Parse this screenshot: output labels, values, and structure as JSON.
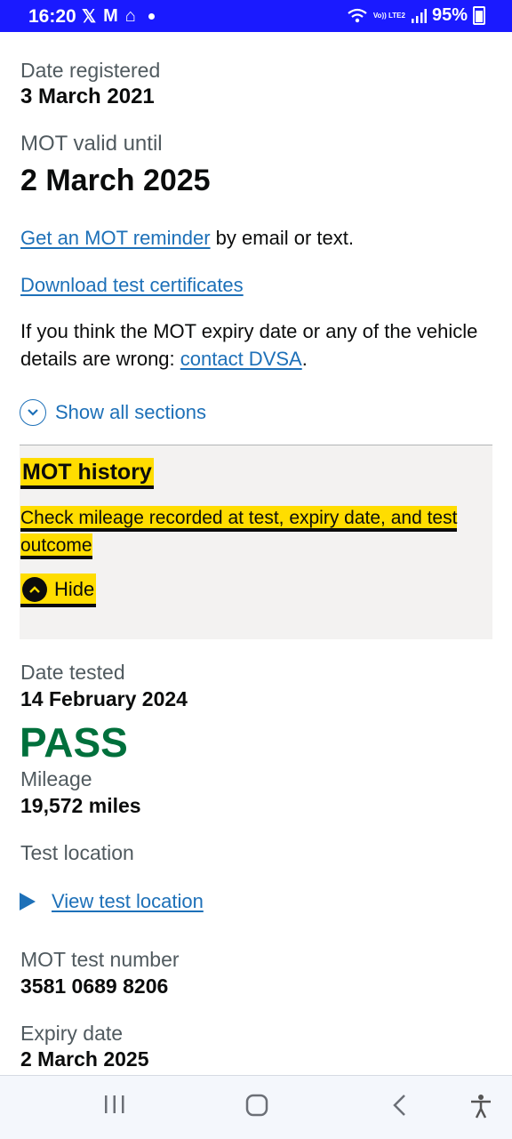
{
  "status_bar": {
    "time": "16:20",
    "left_icons": [
      "x-icon",
      "gmail-icon",
      "home-icon",
      "dot-icon"
    ],
    "network": "Vo)) LTE2",
    "battery": "95%"
  },
  "vehicle": {
    "date_registered_label": "Date registered",
    "date_registered_value": "3 March 2021",
    "mot_valid_label": "MOT valid until",
    "mot_valid_value": "2 March 2025"
  },
  "links": {
    "mot_reminder_link": "Get an MOT reminder",
    "mot_reminder_suffix": " by email or text.",
    "download_link": "Download test certificates",
    "wrong_details_text": "If you think the MOT expiry date or any of the vehicle details are wrong: ",
    "contact_link": "contact DVSA",
    "contact_suffix": "."
  },
  "show_all": {
    "label": "Show all sections"
  },
  "accordion": {
    "title": "MOT history",
    "summary": "Check mileage recorded at test, expiry date, and test outcome",
    "hide_label": "Hide"
  },
  "test": {
    "date_tested_label": "Date tested",
    "date_tested_value": "14 February 2024",
    "result": "PASS",
    "mileage_label": "Mileage",
    "mileage_value": "19,572 miles",
    "location_label": "Test location",
    "location_link": "View test location",
    "test_number_label": "MOT test number",
    "test_number_value": "3581 0689 8206",
    "expiry_label": "Expiry date",
    "expiry_value": "2 March 2025"
  },
  "colors": {
    "link": "#1d70b8",
    "pass": "#00703c",
    "focus_yellow": "#ffdd00",
    "status_bar": "#1a1aff"
  }
}
